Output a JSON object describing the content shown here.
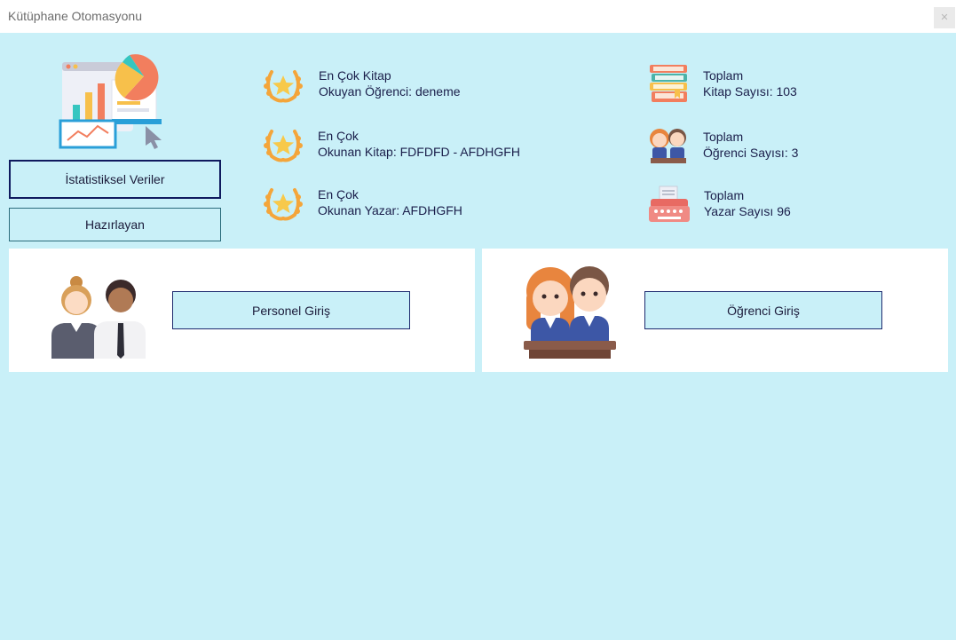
{
  "window": {
    "title": "Kütüphane Otomasyonu",
    "close_label": "✕"
  },
  "sidebar": {
    "stats_button": "İstatistiksel Veriler",
    "about_button": "Hazırlayan"
  },
  "stats": {
    "top_student": {
      "line1": "En Çok Kitap",
      "line2": "Okuyan Öğrenci: deneme"
    },
    "top_book": {
      "line1": "En Çok",
      "line2": "Okunan Kitap: FDFDFD - AFDHGFH"
    },
    "top_author": {
      "line1": "En Çok",
      "line2": "Okunan Yazar: AFDHGFH"
    },
    "total_books": {
      "line1": "Toplam",
      "line2": "Kitap Sayısı: 103"
    },
    "total_students": {
      "line1": "Toplam",
      "line2": "Öğrenci Sayısı: 3"
    },
    "total_authors": {
      "line1": "Toplam",
      "line2": "Yazar Sayısı 96"
    }
  },
  "login": {
    "staff_button": "Personel Giriş",
    "student_button": "Öğrenci Giriş"
  },
  "icons": {
    "dashboard": "dashboard-chart-icon",
    "award": "laurel-star-icon",
    "books": "books-stack-icon",
    "students": "students-icon",
    "typewriter": "typewriter-icon",
    "staff": "staff-people-icon"
  }
}
